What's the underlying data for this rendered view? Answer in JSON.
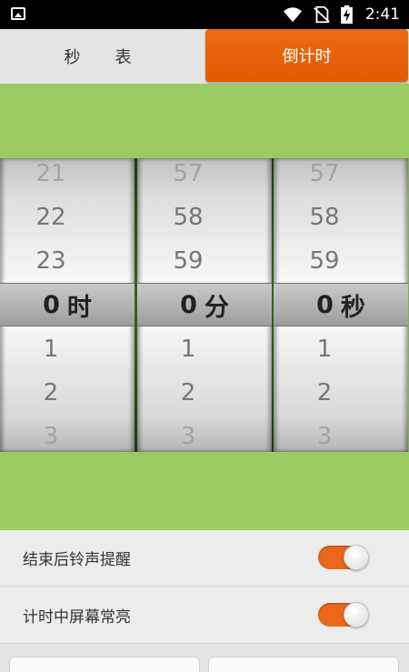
{
  "status_bar": {
    "time": "2:41",
    "icons": [
      "image-notification-icon",
      "wifi-icon",
      "no-sim-icon",
      "battery-charging-icon"
    ]
  },
  "tabs": [
    {
      "label": "秒　表",
      "active": false
    },
    {
      "label": "倒计时",
      "active": true
    }
  ],
  "pickers": {
    "hours": {
      "above": [
        "21",
        "22",
        "23"
      ],
      "selected": "0",
      "unit": "时",
      "below": [
        "1",
        "2",
        "3"
      ]
    },
    "minutes": {
      "above": [
        "57",
        "58",
        "59"
      ],
      "selected": "0",
      "unit": "分",
      "below": [
        "1",
        "2",
        "3"
      ]
    },
    "seconds": {
      "above": [
        "57",
        "58",
        "59"
      ],
      "selected": "0",
      "unit": "秒",
      "below": [
        "1",
        "2",
        "3"
      ]
    }
  },
  "settings": [
    {
      "label": "结束后铃声提醒",
      "enabled": true
    },
    {
      "label": "计时中屏幕常亮",
      "enabled": true
    }
  ],
  "colors": {
    "accent": "#e9661a",
    "green_background": "#9acb63"
  }
}
